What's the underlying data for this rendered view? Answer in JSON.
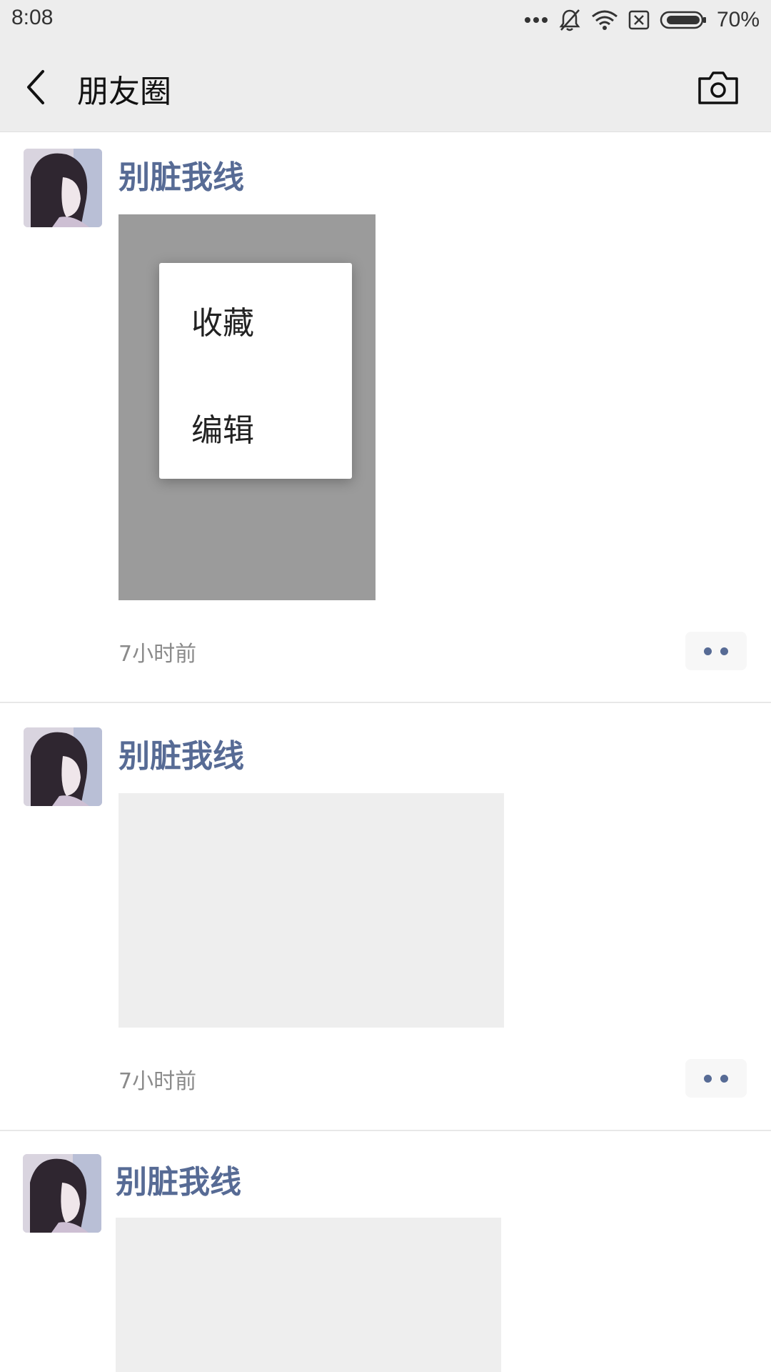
{
  "status_bar": {
    "time": "8:08",
    "battery_percent": "70%",
    "icons": [
      "more-dots-icon",
      "bell-muted-icon",
      "wifi-icon",
      "no-sim-icon",
      "battery-icon"
    ]
  },
  "header": {
    "title": "朋友圈",
    "back_icon": "chevron-left-icon",
    "camera_icon": "camera-icon"
  },
  "context_menu": {
    "items": [
      {
        "label": "收藏"
      },
      {
        "label": "编辑"
      }
    ]
  },
  "posts": [
    {
      "username": "别脏我线",
      "time": "7小时前",
      "image_state": "pressed"
    },
    {
      "username": "别脏我线",
      "time": "7小时前",
      "image_state": "placeholder"
    },
    {
      "username": "别脏我线",
      "image_state": "placeholder"
    }
  ],
  "colors": {
    "username": "#576b95",
    "header_bg": "#ededed",
    "placeholder": "#eeeeee",
    "pressed_overlay": "#9b9b9b"
  }
}
